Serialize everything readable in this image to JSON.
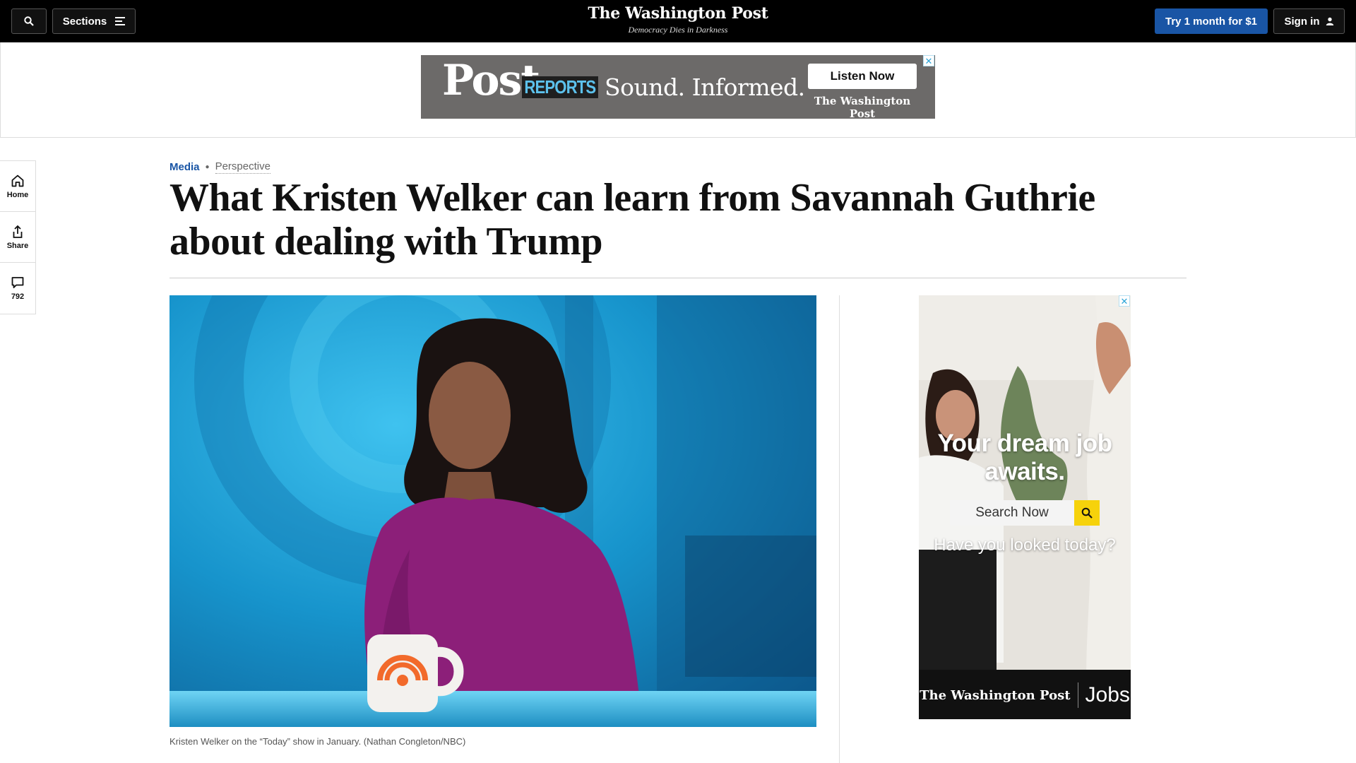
{
  "topbar": {
    "sections_label": "Sections",
    "logo": "The Washington Post",
    "tagline": "Democracy Dies in Darkness",
    "subscribe_label": "Try 1 month for $1",
    "signin_label": "Sign in"
  },
  "banner_ad": {
    "brand": "Post",
    "brand_suffix": "REPORTS",
    "slogan": "Sound. Informed.",
    "cta": "Listen Now",
    "publisher": "The Washington Post",
    "close": "✕"
  },
  "rail": {
    "home_label": "Home",
    "share_label": "Share",
    "comments_count": "792"
  },
  "article": {
    "section": "Media",
    "label": "Perspective",
    "headline": "What Kristen Welker can learn from Savannah Guthrie about dealing with Trump",
    "caption": "Kristen Welker on the “Today” show in January. (Nathan Congleton/NBC)"
  },
  "side_ad": {
    "headline": "Your dream job awaits.",
    "search_label": "Search Now",
    "question": "Have you looked today?",
    "publisher": "The Washington Post",
    "product": "Jobs",
    "close": "✕"
  },
  "colors": {
    "topbar": "#000000",
    "accent_blue": "#1955a5",
    "banner_bg": "#6c6a69",
    "reports_cyan": "#5cc1ec",
    "jobs_yellow": "#f6d20b",
    "hero_blue": "#1a9bd0",
    "sweater_magenta": "#8c1f79"
  }
}
